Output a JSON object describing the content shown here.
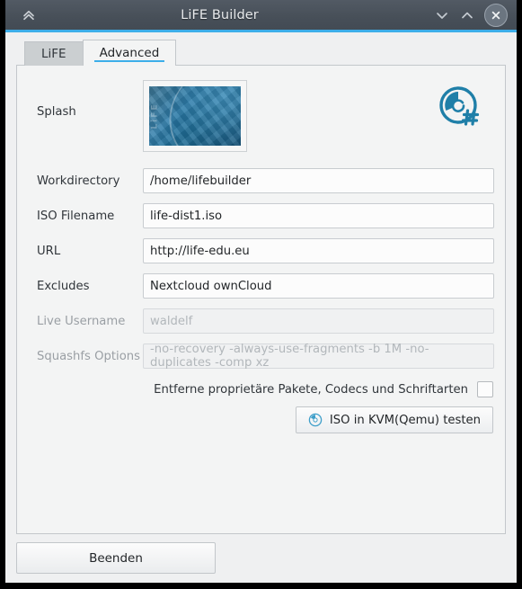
{
  "window": {
    "title": "LiFE Builder",
    "shade_icon": "double-chevron-up-icon",
    "minimize_icon": "chevron-down-icon",
    "maximize_icon": "chevron-up-icon",
    "close_icon": "close-x-icon",
    "accent_color": "#3daee9",
    "titlebar_color": "#4a525c"
  },
  "tabs": [
    {
      "label": "LiFE",
      "active": false
    },
    {
      "label": "Advanced",
      "active": true
    }
  ],
  "form": {
    "splash": {
      "label": "Splash",
      "image_caption": "LiFE"
    },
    "logo": {
      "name": "life-disc-hash-logo",
      "color": "#1f7fa8"
    },
    "fields": [
      {
        "label": "Workdirectory",
        "value": "/home/lifebuilder",
        "placeholder": "",
        "disabled": false,
        "name": "workdirectory"
      },
      {
        "label": "ISO Filename",
        "value": "life-dist1.iso",
        "placeholder": "",
        "disabled": false,
        "name": "iso-filename"
      },
      {
        "label": "URL",
        "value": "http://life-edu.eu",
        "placeholder": "",
        "disabled": false,
        "name": "url"
      },
      {
        "label": "Excludes",
        "value": "Nextcloud ownCloud",
        "placeholder": "",
        "disabled": false,
        "name": "excludes"
      },
      {
        "label": "Live Username",
        "value": "",
        "placeholder": "waldelf",
        "disabled": true,
        "name": "live-username"
      },
      {
        "label": "Squashfs Options",
        "value": "",
        "placeholder": "-no-recovery -always-use-fragments -b 1M -no-duplicates -comp xz",
        "disabled": true,
        "name": "squashfs-options"
      }
    ],
    "checkbox": {
      "label": "Entferne proprietäre Pakete, Codecs und Schriftarten",
      "checked": false
    },
    "kvm_button": {
      "label": "ISO in KVM(Qemu) testen",
      "icon": "disc-icon"
    }
  },
  "footer": {
    "quit_label": "Beenden"
  }
}
